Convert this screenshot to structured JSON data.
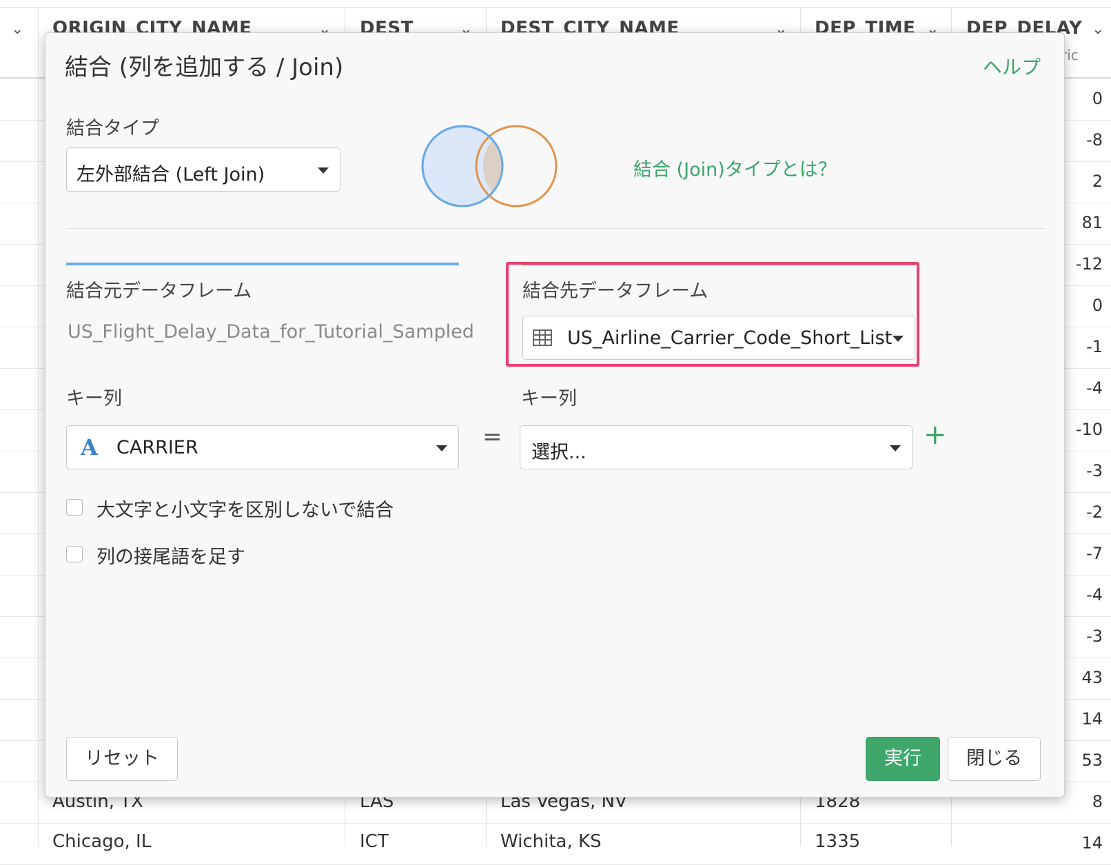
{
  "grid": {
    "columns": [
      {
        "name": "ORIGIN_CITY_NAME"
      },
      {
        "name": "DEST"
      },
      {
        "name": "DEST_CITY_NAME"
      },
      {
        "name": "DEP_TIME"
      },
      {
        "name": "DEP_DELAY",
        "sub": "ric"
      }
    ],
    "dep_delay_values": [
      "0",
      "-8",
      "2",
      "81",
      "-12",
      "0",
      "-1",
      "-4",
      "-10",
      "-3",
      "-2",
      "-7",
      "-4",
      "-3",
      "43",
      "14",
      "53",
      "8",
      "14"
    ],
    "bottom_rows": [
      {
        "origin": "Austin, TX",
        "dest": "LAS",
        "dest_city": "Las Vegas, NV",
        "dep_time": "1828"
      },
      {
        "origin": "Chicago, IL",
        "dest": "ICT",
        "dest_city": "Wichita, KS",
        "dep_time": "1335"
      }
    ]
  },
  "modal": {
    "title": "結合 (列を追加する / Join)",
    "help": "ヘルプ",
    "join_type_label": "結合タイプ",
    "join_type_value": "左外部結合 (Left Join)",
    "join_type_link": "結合 (Join)タイプとは？",
    "source_label": "結合元データフレーム",
    "source_value": "US_Flight_Delay_Data_for_Tutorial_Sampled",
    "target_label": "結合先データフレーム",
    "target_value": "US_Airline_Carrier_Code_Short_List",
    "key_label_left": "キー列",
    "key_label_right": "キー列",
    "key_left_type": "A",
    "key_left_value": "CARRIER",
    "key_right_value": "選択...",
    "equals": "=",
    "plus": "+",
    "case_insensitive_label": "大文字と小文字を区別しないで結合",
    "suffix_label": "列の接尾語を足す",
    "reset_label": "リセット",
    "run_label": "実行",
    "close_label": "閉じる",
    "colors": {
      "accent_green": "#3fa76c",
      "source_blue": "#6aaae8",
      "target_orange": "#e0944a",
      "highlight_pink": "#e8416f"
    }
  }
}
